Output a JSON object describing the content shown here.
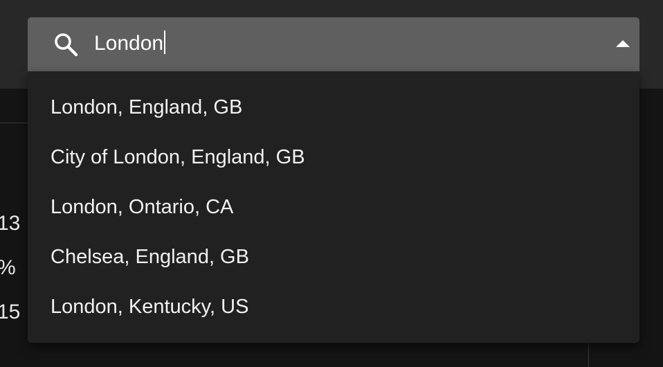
{
  "background": {
    "values": [
      "13",
      "%",
      "15"
    ]
  },
  "search": {
    "icon": "search-icon",
    "value": "London",
    "toggle_icon": "triangle-up-icon"
  },
  "suggestions": [
    {
      "label": "London, England, GB"
    },
    {
      "label": "City of London, England, GB"
    },
    {
      "label": "London, Ontario, CA"
    },
    {
      "label": "Chelsea, England, GB"
    },
    {
      "label": "London, Kentucky, US"
    }
  ],
  "colors": {
    "header": "#282828",
    "page": "#141414",
    "search_field": "#5f5f5f",
    "dropdown": "#212121",
    "text": "#ffffff"
  }
}
